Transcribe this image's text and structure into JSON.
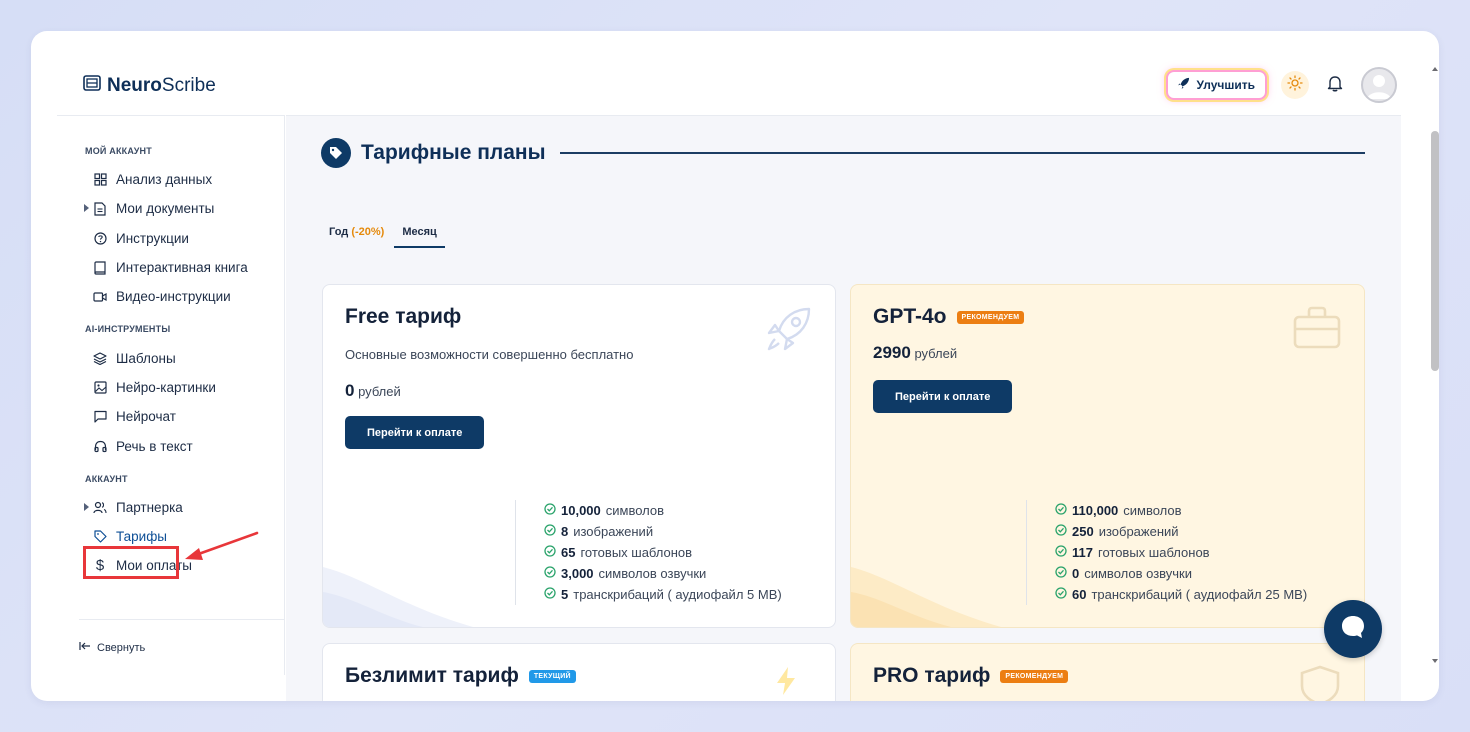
{
  "app": {
    "logo_bold": "Neuro",
    "logo_light": "Scribe"
  },
  "header": {
    "upgrade_label": "Улучшить"
  },
  "sidebar": {
    "sections": [
      {
        "title": "МОЙ АККАУНТ",
        "items": [
          {
            "label": "Анализ данных"
          },
          {
            "label": "Мои документы"
          },
          {
            "label": "Инструкции"
          },
          {
            "label": "Интерактивная книга"
          },
          {
            "label": "Видео-инструкции"
          }
        ]
      },
      {
        "title": "AI-ИНСТРУМЕНТЫ",
        "items": [
          {
            "label": "Шаблоны"
          },
          {
            "label": "Нейро-картинки"
          },
          {
            "label": "Нейрочат"
          },
          {
            "label": "Речь в текст"
          }
        ]
      },
      {
        "title": "АККАУНТ",
        "items": [
          {
            "label": "Партнерка"
          },
          {
            "label": "Тарифы"
          },
          {
            "label": "Мои оплаты"
          }
        ]
      }
    ],
    "collapse_label": "Свернуть"
  },
  "main": {
    "title": "Тарифные планы",
    "tabs": {
      "year_label": "Год",
      "year_discount": "(-20%)",
      "month_label": "Месяц"
    },
    "cards": [
      {
        "title": "Free тариф",
        "subtitle": "Основные возможности совершенно бесплатно",
        "price": "0",
        "currency": "рублей",
        "button": "Перейти к оплате",
        "features": [
          {
            "value": "10,000",
            "text": "символов"
          },
          {
            "value": "8",
            "text": "изображений"
          },
          {
            "value": "65",
            "text": "готовых шаблонов"
          },
          {
            "value": "3,000",
            "text": "символов озвучки"
          },
          {
            "value": "5",
            "text": "транскрибаций ( аудиофайл 5 MB)"
          }
        ]
      },
      {
        "title": "GPT-4o",
        "badge": "РЕКОМЕНДУЕМ",
        "price": "2990",
        "currency": "рублей",
        "button": "Перейти к оплате",
        "features": [
          {
            "value": "110,000",
            "text": "символов"
          },
          {
            "value": "250",
            "text": "изображений"
          },
          {
            "value": "117",
            "text": "готовых шаблонов"
          },
          {
            "value": "0",
            "text": "символов озвучки"
          },
          {
            "value": "60",
            "text": "транскрибаций ( аудиофайл 25 MB)"
          }
        ]
      },
      {
        "title": "Безлимит тариф",
        "badge": "ТЕКУЩИЙ"
      },
      {
        "title": "PRO тариф",
        "badge": "РЕКОМЕНДУЕМ"
      }
    ]
  },
  "colors": {
    "primary": "#0e3a66",
    "accent_orange": "#ec7e12",
    "accent_blue": "#2199e8",
    "highlight_red": "#e8363a"
  }
}
